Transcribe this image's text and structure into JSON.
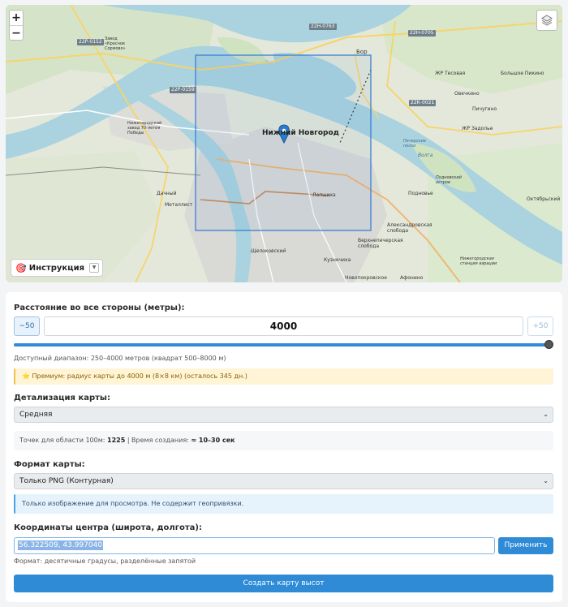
{
  "map": {
    "zoom_in": "+",
    "zoom_out": "−",
    "instruction_label": "Инструкция",
    "instruction_icon": "target-icon",
    "layers_icon": "layers-icon",
    "city_label": "Нижний Новгород",
    "places": {
      "bor": "Бор",
      "zhr_tesovaya": "ЖР Тесовая",
      "bolshoe_pikino": "Большое Пикино",
      "ovechkino": "Овечкино",
      "pichugino": "Пичугино",
      "zhr_zadolye": "ЖР Задолье",
      "pecherskie_peski": "Печерские пески",
      "volga": "Волга",
      "podnovsky": "Подновский остров",
      "podnovye": "Подновье",
      "oktyabrsky": "Октябрьский",
      "zavod_krasnoe": "Завод «Красное Сормово»",
      "nizh_zavod": "Нижегородский завод 70-летия Победы",
      "dachny": "Дачный",
      "metallist": "Металлист",
      "lapshikha": "Лапшиха",
      "aleksandrovskaya": "Александровская слобода",
      "verkhnepecherskaya": "Верхнепечерская слобода",
      "shchelokovsky": "Щелоковский",
      "kuznechikha": "Кузнечиха",
      "novoprokovskoe": "Новопокровское",
      "afonino": "Афонино",
      "station": "Нижегородская станция аэрации"
    },
    "road_shields": [
      "22Р-0152",
      "22Р-0159",
      "22Н-0763",
      "22Н-0705",
      "22К-0021"
    ]
  },
  "form": {
    "distance_label": "Расстояние во все стороны (метры):",
    "minus_label": "−50",
    "plus_label": "+50",
    "distance_value": "4000",
    "range_hint": "Доступный диапазон: 250–4000 метров (квадрат 500–8000 м)",
    "premium_note": "⭐ Премиум: радиус карты до 4000 м (8×8 км) (осталось 345 дн.)",
    "detail_label": "Детализация карты:",
    "detail_selected": "Средняя",
    "stats_prefix": "Точек для области 100м:",
    "stats_points": "1225",
    "stats_sep": "| Время создания:",
    "stats_time": "≈ 10–30 сек",
    "format_label": "Формат карты:",
    "format_selected": "Только PNG (Контурная)",
    "format_info": "Только изображение для просмотра. Не содержит геопривязки.",
    "coords_label": "Координаты центра (широта, долгота):",
    "coords_value": "56.322509, 43.997040",
    "apply_label": "Применить",
    "coords_hint": "Формат: десятичные градусы, разделённые запятой",
    "create_label": "Создать карту высот"
  },
  "colors": {
    "accent": "#2f8bd6",
    "premium_bg": "#fff5d6",
    "info_bg": "#e6f3fd",
    "water": "#aad3df",
    "selection": "#3b7fd4"
  }
}
